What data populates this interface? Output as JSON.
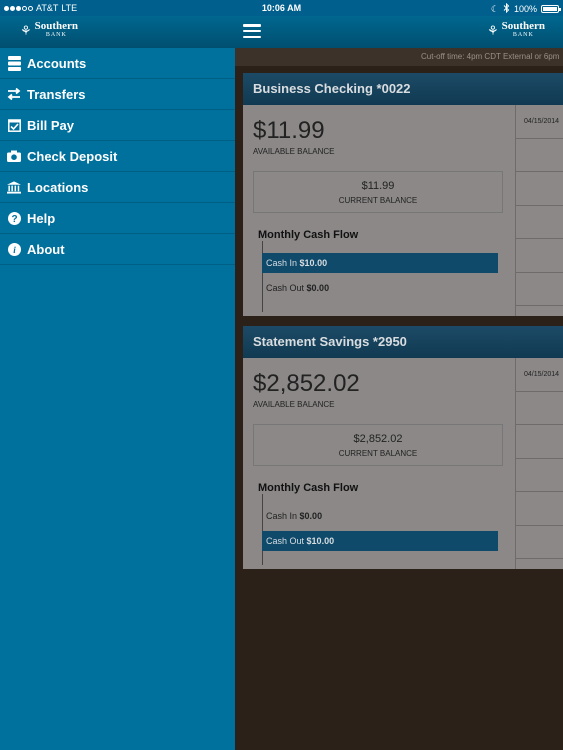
{
  "status_bar": {
    "carrier": "AT&T",
    "network": "LTE",
    "time": "10:06 AM",
    "battery": "100%"
  },
  "brand": {
    "name": "Southern",
    "sub": "BANK"
  },
  "sidebar": {
    "items": [
      {
        "label": "Accounts",
        "icon": "accounts-icon"
      },
      {
        "label": "Transfers",
        "icon": "transfers-icon"
      },
      {
        "label": "Bill Pay",
        "icon": "calendar-check-icon"
      },
      {
        "label": "Check Deposit",
        "icon": "camera-icon"
      },
      {
        "label": "Locations",
        "icon": "bank-building-icon"
      },
      {
        "label": "Help",
        "icon": "help-icon"
      },
      {
        "label": "About",
        "icon": "info-icon"
      }
    ]
  },
  "main": {
    "cutoff_text": "Cut-off time: 4pm CDT External or 6pm",
    "accounts": [
      {
        "name": "Business Checking *0022",
        "available_balance": "$11.99",
        "available_label": "AVAILABLE BALANCE",
        "current_balance": "$11.99",
        "current_label": "CURRENT BALANCE",
        "cash_flow_title": "Monthly Cash Flow",
        "cash_in_label": "Cash In",
        "cash_in_value": "$10.00",
        "cash_out_label": "Cash Out",
        "cash_out_value": "$0.00",
        "recent_date": "04/15/2014"
      },
      {
        "name": "Statement Savings *2950",
        "available_balance": "$2,852.02",
        "available_label": "AVAILABLE BALANCE",
        "current_balance": "$2,852.02",
        "current_label": "CURRENT BALANCE",
        "cash_flow_title": "Monthly Cash Flow",
        "cash_in_label": "Cash In",
        "cash_in_value": "$0.00",
        "cash_out_label": "Cash Out",
        "cash_out_value": "$10.00",
        "recent_date": "04/15/2014"
      }
    ]
  },
  "colors": {
    "sidebar": "#00709c",
    "navbar": "#005a80",
    "card_header": "#1c4a66",
    "flow_bar": "#0f4a6b"
  }
}
